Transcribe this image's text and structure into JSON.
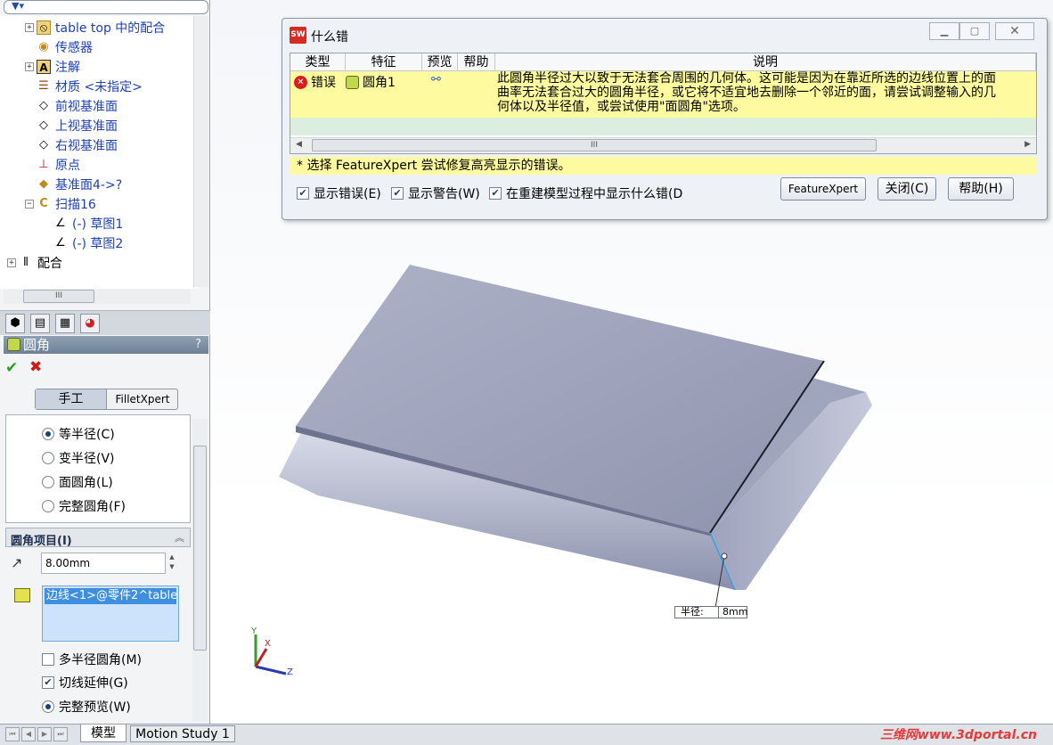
{
  "feature_tree": {
    "items": [
      {
        "label": "table top 中的配合",
        "icon": "mates-folder-icon",
        "expandable": true
      },
      {
        "label": "传感器",
        "icon": "sensor-icon",
        "expandable": false
      },
      {
        "label": "注解",
        "icon": "annotation-icon",
        "expandable": true
      },
      {
        "label": "材质 <未指定>",
        "icon": "material-icon",
        "expandable": false
      },
      {
        "label": "前视基准面",
        "icon": "plane-icon",
        "expandable": false
      },
      {
        "label": "上视基准面",
        "icon": "plane-icon",
        "expandable": false
      },
      {
        "label": "右视基准面",
        "icon": "plane-icon",
        "expandable": false
      },
      {
        "label": "原点",
        "icon": "origin-icon",
        "expandable": false
      },
      {
        "label": "基准面4->?",
        "icon": "plane-warning-icon",
        "expandable": false
      },
      {
        "label": "扫描16",
        "icon": "sweep-icon",
        "expandable": true
      },
      {
        "label": "(-) 草图1",
        "icon": "sketch-icon",
        "expandable": false
      },
      {
        "label": "(-) 草图2",
        "icon": "sketch-icon",
        "expandable": false
      },
      {
        "label": "配合",
        "icon": "mates-icon",
        "expandable": true
      }
    ]
  },
  "property_manager": {
    "title": "圆角",
    "help": "?",
    "mode_tabs": [
      "手工",
      "FilletXpert"
    ],
    "fillet_type_options": [
      "等半径(C)",
      "变半径(V)",
      "面圆角(L)",
      "完整圆角(F)"
    ],
    "selected_type": 0,
    "items_section_title": "圆角项目(I)",
    "radius_value": "8.00mm",
    "edge_selection": "边线<1>@零件2^table top",
    "multi_radius_label": "多半径圆角(M)",
    "tangent_propagation_label": "切线延伸(G)",
    "full_preview_label": "完整预览(W)"
  },
  "error_dialog": {
    "title": "什么错",
    "columns": [
      "类型",
      "特征",
      "预览",
      "帮助",
      "说明"
    ],
    "row": {
      "type": "错误",
      "feature": "圆角1",
      "description_lines": [
        "此圆角半径过大以致于无法套合周围的几何体。这可能是因为在靠近所选的边线位置上的面",
        "曲率无法套合过大的圆角半径，或它将不适宜地去删除一个邻近的面，请尝试调整输入的几",
        "何体以及半径值，或尝试使用\"面圆角\"选项。"
      ]
    },
    "hint": "* 选择 FeatureXpert 尝试修复高亮显示的错误。",
    "checks": [
      "显示错误(E)",
      "显示警告(W)",
      "在重建模型过程中显示什么错(D"
    ],
    "buttons": [
      "FeatureXpert",
      "关闭(C)",
      "帮助(H)"
    ]
  },
  "callout": {
    "key": "半径:",
    "value": "8mm"
  },
  "triad": {
    "x": "X",
    "y": "Y",
    "z": "Z"
  },
  "bottom_tabs": [
    "模型",
    "Motion Study 1"
  ],
  "watermark": "三维网www.3dportal.cn",
  "colors": {
    "error_row": "#fdfa9f",
    "accent": "#3f8fe0",
    "model": "#9aa0bd"
  }
}
